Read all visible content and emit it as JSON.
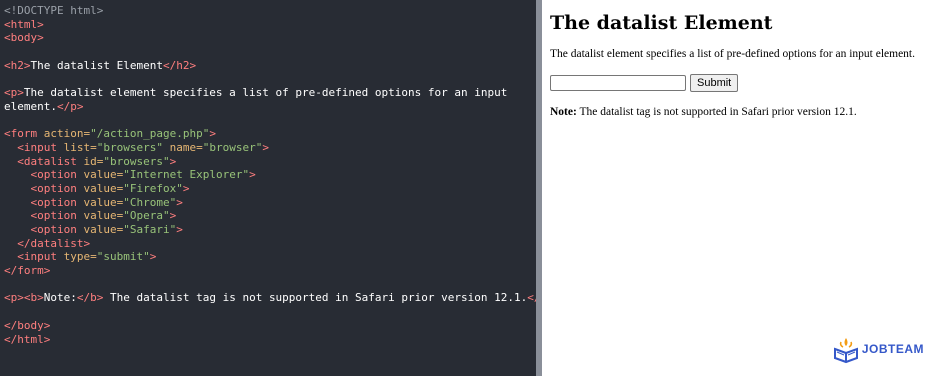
{
  "editor": {
    "lines": [
      [
        [
          "doctype",
          "<!DOCTYPE html>"
        ]
      ],
      [
        [
          "tag",
          "<html>"
        ]
      ],
      [
        [
          "tag",
          "<body>"
        ]
      ],
      [],
      [
        [
          "tag",
          "<h2>"
        ],
        [
          "text",
          "The datalist Element"
        ],
        [
          "tag",
          "</h2>"
        ]
      ],
      [],
      [
        [
          "tag",
          "<p>"
        ],
        [
          "text",
          "The datalist element specifies a list of pre-defined options for an input"
        ]
      ],
      [
        [
          "text",
          "element."
        ],
        [
          "tag",
          "</p>"
        ]
      ],
      [],
      [
        [
          "tag",
          "<form "
        ],
        [
          "attr",
          "action="
        ],
        [
          "val",
          "\"/action_page.php\""
        ],
        [
          "tag",
          ">"
        ]
      ],
      [
        [
          "text",
          "  "
        ],
        [
          "tag",
          "<input "
        ],
        [
          "attr",
          "list="
        ],
        [
          "val",
          "\"browsers\""
        ],
        [
          "attr",
          " name="
        ],
        [
          "val",
          "\"browser\""
        ],
        [
          "tag",
          ">"
        ]
      ],
      [
        [
          "text",
          "  "
        ],
        [
          "tag",
          "<datalist "
        ],
        [
          "attr",
          "id="
        ],
        [
          "val",
          "\"browsers\""
        ],
        [
          "tag",
          ">"
        ]
      ],
      [
        [
          "text",
          "    "
        ],
        [
          "tag",
          "<option "
        ],
        [
          "attr",
          "value="
        ],
        [
          "val",
          "\"Internet Explorer\""
        ],
        [
          "tag",
          ">"
        ]
      ],
      [
        [
          "text",
          "    "
        ],
        [
          "tag",
          "<option "
        ],
        [
          "attr",
          "value="
        ],
        [
          "val",
          "\"Firefox\""
        ],
        [
          "tag",
          ">"
        ]
      ],
      [
        [
          "text",
          "    "
        ],
        [
          "tag",
          "<option "
        ],
        [
          "attr",
          "value="
        ],
        [
          "val",
          "\"Chrome\""
        ],
        [
          "tag",
          ">"
        ]
      ],
      [
        [
          "text",
          "    "
        ],
        [
          "tag",
          "<option "
        ],
        [
          "attr",
          "value="
        ],
        [
          "val",
          "\"Opera\""
        ],
        [
          "tag",
          ">"
        ]
      ],
      [
        [
          "text",
          "    "
        ],
        [
          "tag",
          "<option "
        ],
        [
          "attr",
          "value="
        ],
        [
          "val",
          "\"Safari\""
        ],
        [
          "tag",
          ">"
        ]
      ],
      [
        [
          "text",
          "  "
        ],
        [
          "tag",
          "</datalist>"
        ]
      ],
      [
        [
          "text",
          "  "
        ],
        [
          "tag",
          "<input "
        ],
        [
          "attr",
          "type="
        ],
        [
          "val",
          "\"submit\""
        ],
        [
          "tag",
          ">"
        ]
      ],
      [
        [
          "tag",
          "</form>"
        ]
      ],
      [],
      [
        [
          "tag",
          "<p><b>"
        ],
        [
          "text",
          "Note:"
        ],
        [
          "tag",
          "</b>"
        ],
        [
          "text",
          " The datalist tag is not supported in Safari prior version 12.1."
        ],
        [
          "tag",
          "</p>"
        ]
      ],
      [],
      [
        [
          "tag",
          "</body>"
        ]
      ],
      [
        [
          "tag",
          "</html>"
        ]
      ]
    ]
  },
  "result": {
    "heading": "The datalist Element",
    "description": "The datalist element specifies a list of pre-defined options for an input element.",
    "input_value": "",
    "submit_label": "Submit",
    "note_label": "Note:",
    "note_text": " The datalist tag is not supported in Safari prior version 12.1."
  },
  "logo": {
    "text": "JOBTEAM",
    "icon": "book-logo-icon",
    "color": "#3558c9"
  }
}
